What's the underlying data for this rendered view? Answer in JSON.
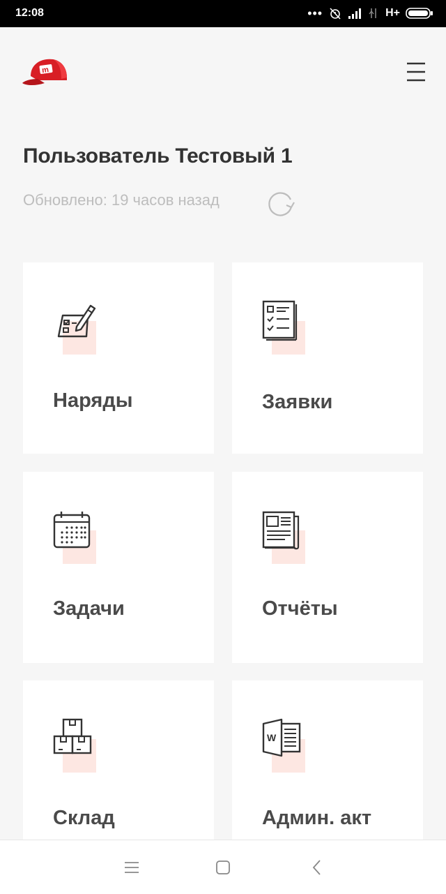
{
  "status_bar": {
    "time": "12:08",
    "network": "H+",
    "icons": [
      "more-dots-icon",
      "alarm-off-icon",
      "signal-icon",
      "signal-weak-icon",
      "battery-icon"
    ]
  },
  "header": {
    "logo_icon": "red-cap-logo",
    "menu_icon": "hamburger-menu-icon"
  },
  "user": {
    "name": "Пользователь Тестовый 1",
    "updated": "Обновлено: 19 часов назад",
    "refresh_icon": "refresh-icon"
  },
  "tiles": [
    {
      "label": "Наряды",
      "icon": "clipboard-pen-icon"
    },
    {
      "label": "Заявки",
      "icon": "checklist-icon"
    },
    {
      "label": "Задачи",
      "icon": "calendar-icon"
    },
    {
      "label": "Отчёты",
      "icon": "newspaper-icon"
    },
    {
      "label": "Склад",
      "icon": "boxes-icon"
    },
    {
      "label": "Админ. акт",
      "icon": "word-document-icon"
    }
  ],
  "nav_bar": {
    "icons": [
      "menu-lines-icon",
      "home-square-icon",
      "back-chevron-icon"
    ]
  },
  "colors": {
    "accent": "#d81e25",
    "icon_highlight": "#fde7e2",
    "background": "#f6f6f6"
  }
}
